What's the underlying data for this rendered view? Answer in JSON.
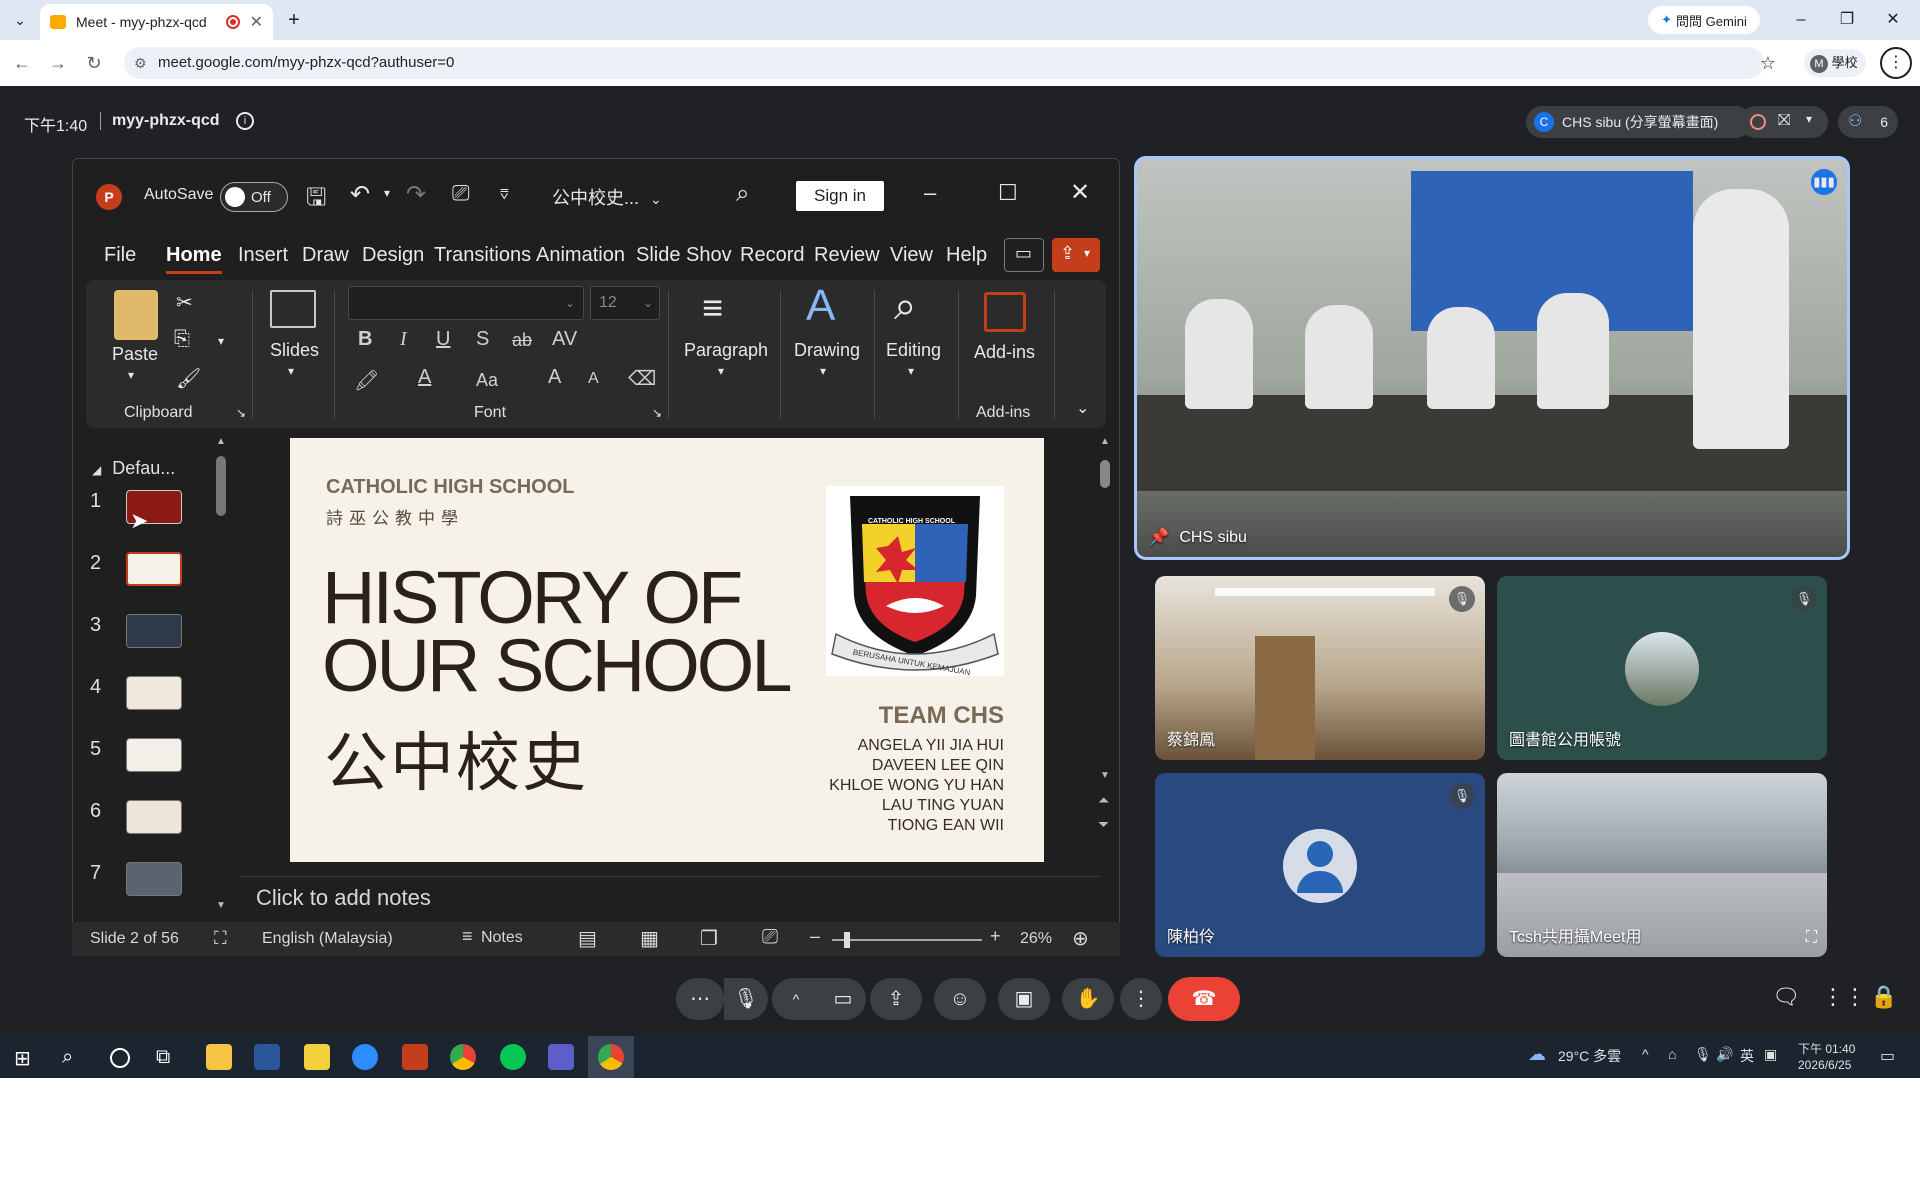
{
  "browser": {
    "tab_title": "Meet - myy-phzx-qcd",
    "gemini_label": "問問 Gemini",
    "url": "meet.google.com/myy-phzx-qcd?authuser=0",
    "profile_label": "學校",
    "profile_initial": "M"
  },
  "meet": {
    "time": "下午1:40",
    "meeting_code": "myy-phzx-qcd",
    "presenter_label": "CHS sibu (分享螢幕畫面)",
    "presenter_initial": "C",
    "participant_count": "6"
  },
  "ppt": {
    "autosave_label": "AutoSave",
    "toggle_state": "Off",
    "file_name": "公中校史...",
    "signin_label": "Sign in",
    "menu": [
      "File",
      "Home",
      "Insert",
      "Draw",
      "Design",
      "Transitions",
      "Animation",
      "Slide Shov",
      "Record",
      "Review",
      "View",
      "Help"
    ],
    "ribbon": {
      "paste": "Paste",
      "clipboard": "Clipboard",
      "slides": "Slides",
      "font": "Font",
      "font_size": "12",
      "paragraph": "Paragraph",
      "drawing": "Drawing",
      "editing": "Editing",
      "addins_btn": "Add-ins",
      "addins_group": "Add-ins",
      "bold": "B",
      "italic": "I",
      "underline": "U",
      "strike": "S",
      "abc": "ab",
      "av": "AV",
      "aa": "Aa",
      "grow": "A",
      "shrink": "A"
    },
    "section_name": "Defau...",
    "thumbnails": [
      "1",
      "2",
      "3",
      "4",
      "5",
      "6",
      "7"
    ],
    "slide": {
      "school_en": "CATHOLIC HIGH SCHOOL",
      "school_zh": "詩巫公教中學",
      "title_line1": "HISTORY OF",
      "title_line2": "OUR SCHOOL",
      "title_zh": "公中校史",
      "crest_top": "CATHOLIC HIGH SCHOOL",
      "crest_motto": "BERUSAHA UNTUK KEMAJUAN",
      "team_label": "TEAM CHS",
      "members": [
        "ANGELA YII JIA HUI",
        "DAVEEN LEE QIN",
        "KHLOE WONG YU HAN",
        "LAU TING YUAN",
        "TIONG EAN WII"
      ]
    },
    "notes_placeholder": "Click to add notes",
    "status": {
      "slide_counter": "Slide 2 of 56",
      "language": "English (Malaysia)",
      "notes_label": "Notes",
      "zoom": "26%"
    }
  },
  "participants": [
    {
      "name": "CHS sibu"
    },
    {
      "name": "蔡錦鳳"
    },
    {
      "name": "圖書館公用帳號"
    },
    {
      "name": "陳柏伶"
    },
    {
      "name": "Tcsh共用攝Meet用"
    }
  ],
  "taskbar": {
    "weather": "29°C 多雲",
    "ime_label": "英",
    "clock_time": "下午 01:40",
    "clock_date": "2026/6/25"
  },
  "colors": {
    "meet_bg": "#202124",
    "ppt_accent": "#c43e1c",
    "end_call": "#ea4335",
    "active_speaker_border": "#a8c7fa"
  }
}
